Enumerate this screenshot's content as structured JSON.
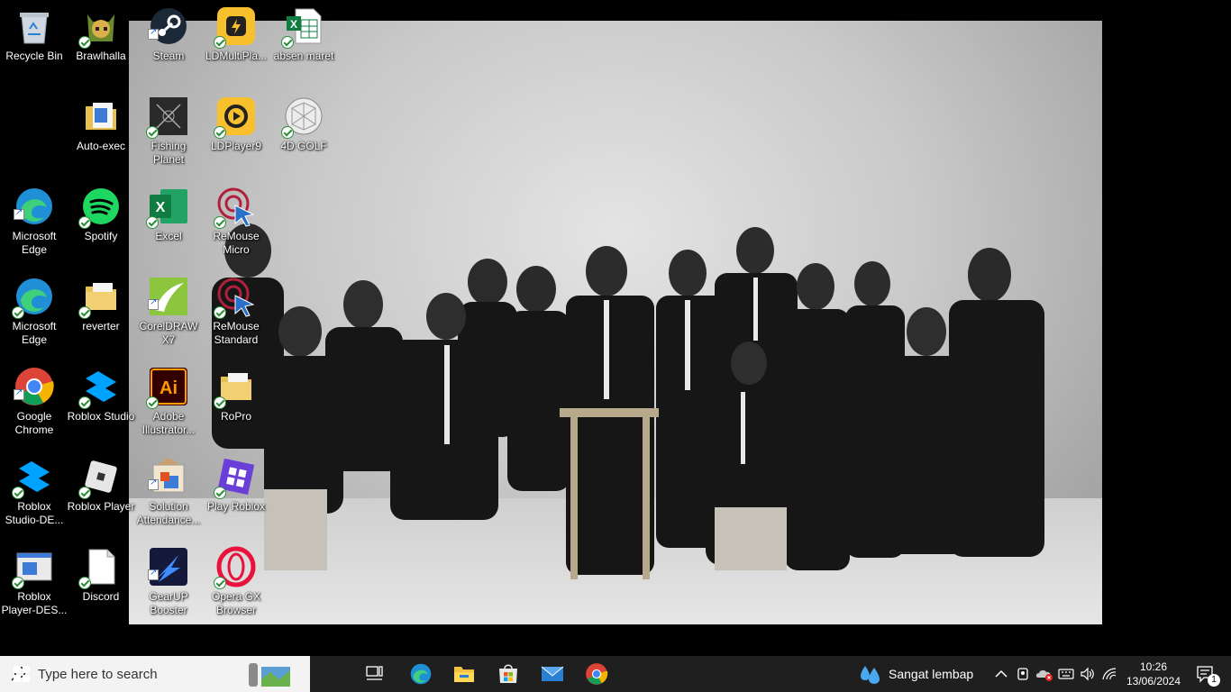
{
  "desktop": {
    "icons": [
      {
        "label": "Recycle Bin"
      },
      {
        "label": "Brawlhalla"
      },
      {
        "label": "Steam"
      },
      {
        "label": "LDMultiPla..."
      },
      {
        "label": "absen maret"
      },
      {
        "label": "Auto-exec"
      },
      {
        "label": "Fishing Planet"
      },
      {
        "label": "LDPlayer9"
      },
      {
        "label": "4D GOLF"
      },
      {
        "label": "Microsoft Edge"
      },
      {
        "label": "Spotify"
      },
      {
        "label": "Excel"
      },
      {
        "label": "ReMouse Micro"
      },
      {
        "label": "Microsoft Edge"
      },
      {
        "label": "reverter"
      },
      {
        "label": "CorelDRAW X7"
      },
      {
        "label": "ReMouse Standard"
      },
      {
        "label": "Google Chrome"
      },
      {
        "label": "Roblox Studio"
      },
      {
        "label": "Adobe Illustrator..."
      },
      {
        "label": "RoPro"
      },
      {
        "label": "Roblox Studio-DE..."
      },
      {
        "label": "Roblox Player"
      },
      {
        "label": "Solution Attendance..."
      },
      {
        "label": "Play Roblox"
      },
      {
        "label": "Roblox Player-DES..."
      },
      {
        "label": "Discord"
      },
      {
        "label": "GearUP Booster"
      },
      {
        "label": "Opera GX Browser"
      }
    ],
    "excel_glyph": "X",
    "illustrator_glyph": "Ai"
  },
  "taskbar": {
    "search_placeholder": "Type here to search",
    "weather_text": "Sangat lembap",
    "time": "10:26",
    "date": "13/06/2024",
    "notification_count": "1",
    "accent": "#0078d4"
  }
}
